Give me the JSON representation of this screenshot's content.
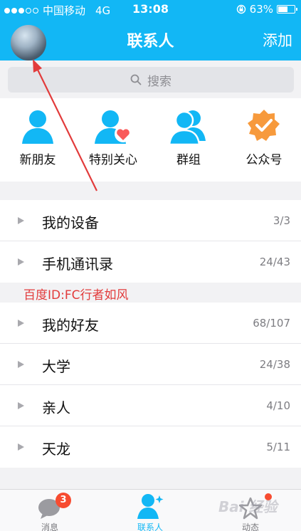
{
  "status_bar": {
    "carrier": "中国移动",
    "network": "4G",
    "time": "13:08",
    "battery": "63%",
    "battery_level": 0.63
  },
  "nav": {
    "title": "联系人",
    "add_label": "添加"
  },
  "search": {
    "placeholder": "搜索"
  },
  "quick_entries": [
    {
      "label": "新朋友",
      "icon": "new-friend-icon"
    },
    {
      "label": "特别关心",
      "icon": "special-care-icon"
    },
    {
      "label": "群组",
      "icon": "group-icon"
    },
    {
      "label": "公众号",
      "icon": "official-account-icon"
    }
  ],
  "groups": [
    {
      "name": "我的设备",
      "count": "3/3"
    },
    {
      "name": "手机通讯录",
      "count": "24/43"
    },
    {
      "name": "我的好友",
      "count": "68/107"
    },
    {
      "name": "大学",
      "count": "24/38"
    },
    {
      "name": "亲人",
      "count": "4/10"
    },
    {
      "name": "天龙",
      "count": "5/11"
    }
  ],
  "watermark_text": "百度ID:FC行者如风",
  "watermark_logo": "Baidu 经验",
  "tabs": [
    {
      "label": "消息",
      "badge": "3"
    },
    {
      "label": "联系人"
    },
    {
      "label": "动态"
    }
  ],
  "colors": {
    "accent": "#12b7f5",
    "badge": "#f74c31",
    "annotation": "#e23b3b",
    "special_heart": "#f95a5a",
    "official_badge": "#f79a3c"
  }
}
